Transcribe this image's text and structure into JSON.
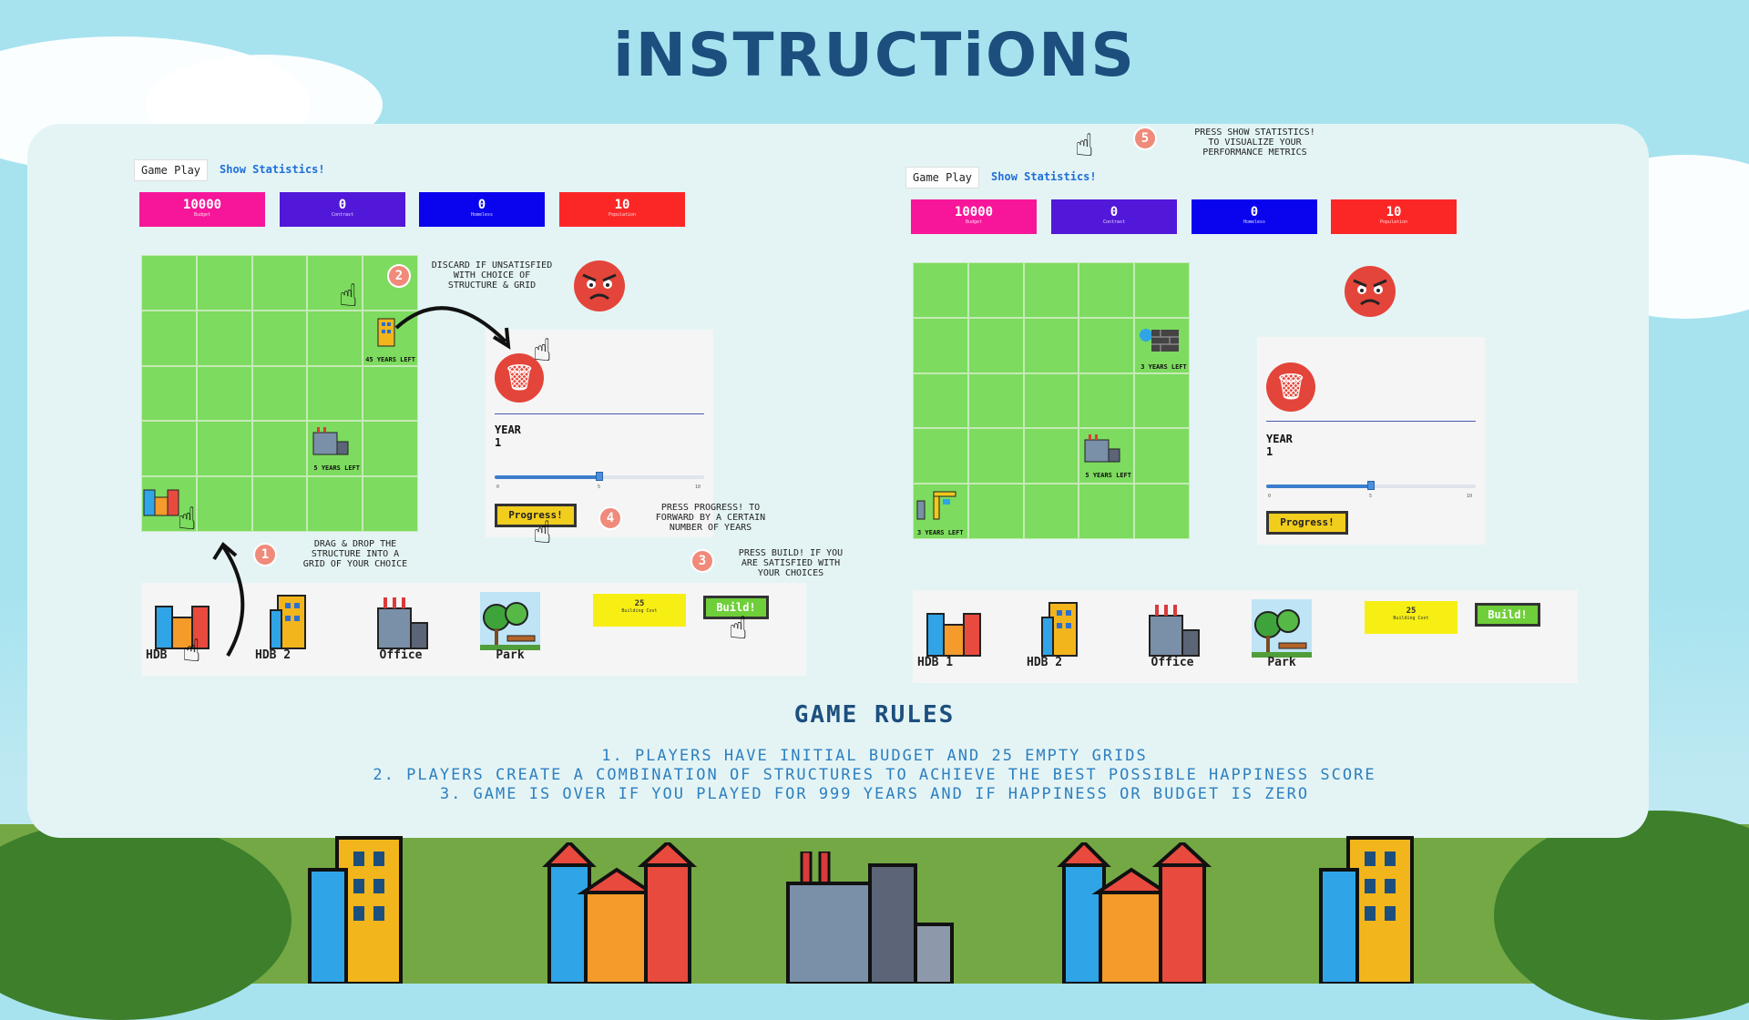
{
  "title": "iNSTRUCTiONS",
  "tabs": {
    "game_play": "Game Play",
    "show_stats": "Show Statistics!"
  },
  "stats": [
    {
      "value": "10000",
      "label": "Budget",
      "color": "#f7169a"
    },
    {
      "value": "0",
      "label": "Contrast",
      "color": "#5218d9"
    },
    {
      "value": "0",
      "label": "Homeless",
      "color": "#0a04ee"
    },
    {
      "value": "10",
      "label": "Population",
      "color": "#fb2727"
    }
  ],
  "left_grid": {
    "labels": {
      "hdb2": "45 YEARS LEFT",
      "office": "5 YEARS LEFT"
    }
  },
  "right_grid": {
    "labels": {
      "wall": "3 YEARS LEFT",
      "office": "5 YEARS LEFT",
      "crane": "3 YEARS LEFT"
    }
  },
  "control": {
    "year_label": "YEAR",
    "year_value": "1",
    "slider_ticks": [
      "0",
      "5",
      "10"
    ],
    "slider_value": 0.5,
    "progress_label": "Progress!"
  },
  "palette": {
    "items_left": [
      "HDB",
      "HDB 2",
      "Office",
      "Park"
    ],
    "items_right": [
      "HDB 1",
      "HDB 2",
      "Office",
      "Park"
    ],
    "cost_value": "25",
    "cost_label": "Building Cost",
    "build_label": "Build!"
  },
  "notes": {
    "n1": {
      "num": "1",
      "text": "Drag & drop the\nstructure into a\ngrid of your choice"
    },
    "n2": {
      "num": "2",
      "text": "Discard if unsatisfied\nwith choice of\nstructure & grid"
    },
    "n3": {
      "num": "3",
      "text": "Press Build! if you\nare satisfied with\nyour choices"
    },
    "n4": {
      "num": "4",
      "text": "Press Progress! to\nforward by a certain\nnumber of years"
    },
    "n5": {
      "num": "5",
      "text": "Press Show Statistics!\nto visualize your\nperformance metrics"
    }
  },
  "rules": {
    "title": "GAME RULES",
    "lines": [
      "1. Players have initial budget and 25 empty grids",
      "2. Players create a combination of structures to achieve the best possible happiness score",
      "3. Game is over if you played for 999 years and if happiness or budget is zero"
    ]
  }
}
